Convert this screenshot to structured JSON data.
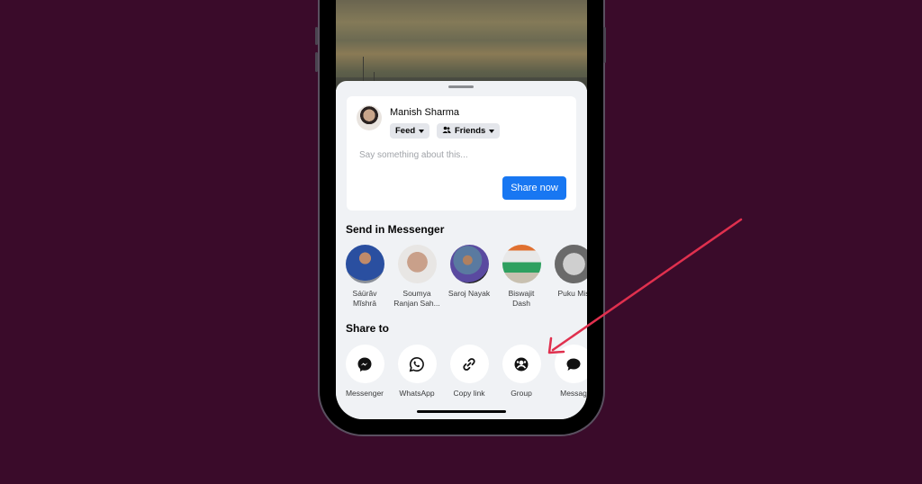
{
  "composer": {
    "user_name": "Manish Sharma",
    "audience_feed": "Feed",
    "audience_friends": "Friends",
    "placeholder": "Say something about this...",
    "share_now_label": "Share now"
  },
  "messenger": {
    "title": "Send in Messenger",
    "contacts": [
      {
        "name_line1": "Sáürâv",
        "name_line2": "Mĭshrā",
        "avatar_color": "#2a4fa0"
      },
      {
        "name_line1": "Soumya",
        "name_line2": "Ranjan Sah...",
        "avatar_color": "#c9a08a"
      },
      {
        "name_line1": "Saroj Nayak",
        "name_line2": "",
        "avatar_color": "#5a4aa0"
      },
      {
        "name_line1": "Biswajit",
        "name_line2": "Dash",
        "avatar_color": "#2fa060"
      },
      {
        "name_line1": "Puku Mis",
        "name_line2": "",
        "avatar_color": "#6a6a6a"
      }
    ]
  },
  "share_to": {
    "title": "Share to",
    "targets": [
      {
        "label": "Messenger",
        "icon": "messenger-icon"
      },
      {
        "label": "WhatsApp",
        "icon": "whatsapp-icon"
      },
      {
        "label": "Copy link",
        "icon": "link-icon"
      },
      {
        "label": "Group",
        "icon": "group-icon"
      },
      {
        "label": "Messag",
        "icon": "message-icon"
      }
    ]
  },
  "colors": {
    "accent": "#1877f2",
    "annotation_arrow": "#e0304e",
    "background": "#3a0b2a"
  }
}
